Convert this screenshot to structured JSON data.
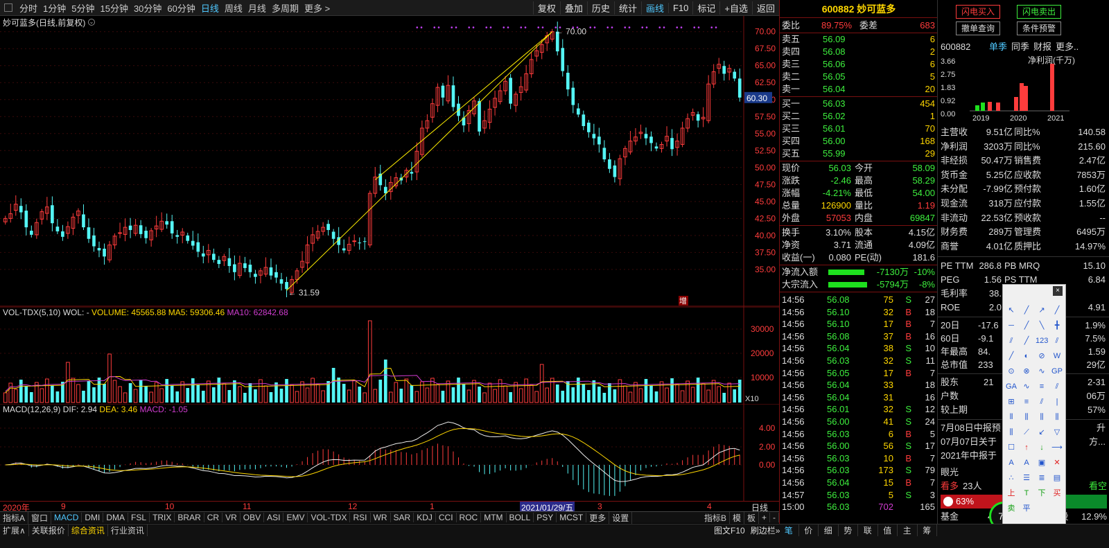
{
  "toolbar": {
    "left": [
      "分时",
      "1分钟",
      "5分钟",
      "15分钟",
      "30分钟",
      "60分钟",
      "日线",
      "周线",
      "月线",
      "多周期",
      "更多 >"
    ],
    "active": "日线",
    "right": [
      "复权",
      "叠加",
      "历史",
      "统计",
      "画线",
      "F10",
      "标记",
      "+自选",
      "返回"
    ],
    "right_active": "画线"
  },
  "chart": {
    "title": "妙可蓝多(日线,前复权)",
    "price_ticks": [
      "70.00",
      "67.50",
      "65.00",
      "62.50",
      "60.00",
      "57.50",
      "55.00",
      "52.50",
      "50.00",
      "47.50",
      "45.00",
      "42.50",
      "40.00",
      "37.50",
      "35.00"
    ],
    "current_price_tag": "60.30",
    "high_label": "70.00",
    "low_label": "31.59",
    "zeng_label": "增",
    "vol_title": "VOL-TDX(5,10)",
    "vol_wol": "WOL: -",
    "vol_volume": "VOLUME: 45565.88",
    "vol_ma5": "MA5: 59306.46",
    "vol_ma10": "MA10: 62842.68",
    "vol_ticks": [
      "30000",
      "20000",
      "10000"
    ],
    "vol_unit": "X10",
    "macd_title": "MACD(12,26,9)",
    "macd_dif": "DIF: 2.94",
    "macd_dea": "DEA: 3.46",
    "macd_val": "MACD: -1.05",
    "macd_ticks": [
      "4.00",
      "2.00",
      "0.00"
    ],
    "date_labels": [
      "2020年",
      "9",
      "10",
      "11",
      "12",
      "1",
      "2021/01/29/五",
      "3",
      "4"
    ],
    "period_label": "日线"
  },
  "chart_data": {
    "type": "candlestick",
    "price_range": [
      30.5,
      71.5
    ],
    "closes": [
      42.5,
      43.2,
      44.6,
      43.4,
      41.2,
      40.1,
      41.9,
      43.5,
      44.2,
      41.8,
      40.6,
      39.8,
      41.3,
      42.7,
      43.6,
      41.2,
      39.5,
      38.4,
      37.8,
      36.9,
      38.6,
      39.9,
      40.4,
      41.2,
      40.8,
      41.5,
      40.2,
      39.6,
      40.7,
      41.4,
      42.1,
      41.6,
      40.3,
      39.8,
      40.5,
      39.2,
      38.5,
      37.6,
      36.9,
      37.8,
      36.4,
      35.8,
      36.9,
      35.5,
      34.6,
      35.9,
      35.2,
      34.6,
      33.9,
      34.8,
      35.3,
      34.1,
      33.8,
      32.9,
      32.1,
      33.5,
      34.8,
      36.2,
      38.6,
      40.1,
      40.6,
      41.2,
      40.8,
      39.5,
      38.6,
      37.8,
      38.7,
      39.2,
      38.9,
      39.1,
      46.2,
      48.6,
      47.4,
      46.2,
      47.8,
      48.5,
      48.1,
      49.6,
      49.1,
      52.4,
      55.8,
      56.9,
      59.4,
      61.8,
      60.3,
      62.1,
      58.9,
      57.6,
      56.2,
      58.4,
      59.8,
      55.3,
      56.9,
      58.6,
      60.2,
      61.3,
      62.7,
      59.4,
      60.8,
      61.9,
      63.8,
      65.9,
      67.2,
      68.1,
      69.4,
      70.0,
      67.1,
      64.2,
      61.5,
      59.2,
      57.8,
      56.1,
      55.2,
      54.3,
      53.4,
      51.2,
      49.8,
      48.6,
      51.3,
      52.8,
      53.9,
      54.5,
      55.2,
      54.3,
      53.6,
      52.8,
      53.4,
      54.6,
      52.7,
      53.9,
      55.8,
      57.2,
      58.1,
      56.9,
      57.4,
      62.3,
      64.1,
      65.2,
      63.8,
      64.6,
      63.1,
      60.3
    ],
    "volume_ticks": [
      30000,
      20000,
      10000
    ],
    "macd_ticks": [
      4.0,
      2.0,
      0.0
    ]
  },
  "quote": {
    "code_name": "600882 妙可蓝多",
    "weibi_label": "委比",
    "weibi": "89.75%",
    "weicha_label": "委差",
    "weicha": "683",
    "sells": [
      {
        "label": "卖五",
        "price": "56.09",
        "vol": "6"
      },
      {
        "label": "卖四",
        "price": "56.08",
        "vol": "2"
      },
      {
        "label": "卖三",
        "price": "56.06",
        "vol": "6"
      },
      {
        "label": "卖二",
        "price": "56.05",
        "vol": "5"
      },
      {
        "label": "卖一",
        "price": "56.04",
        "vol": "20"
      }
    ],
    "buys": [
      {
        "label": "买一",
        "price": "56.03",
        "vol": "454"
      },
      {
        "label": "买二",
        "price": "56.02",
        "vol": "1"
      },
      {
        "label": "买三",
        "price": "56.01",
        "vol": "70"
      },
      {
        "label": "买四",
        "price": "56.00",
        "vol": "168"
      },
      {
        "label": "买五",
        "price": "55.99",
        "vol": "29"
      }
    ],
    "stats": [
      {
        "l1": "现价",
        "v1": "56.03",
        "l2": "今开",
        "v2": "58.09"
      },
      {
        "l1": "涨跌",
        "v1": "-2.46",
        "l2": "最高",
        "v2": "58.29"
      },
      {
        "l1": "涨幅",
        "v1": "-4.21%",
        "l2": "最低",
        "v2": "54.00"
      },
      {
        "l1": "总量",
        "v1": "126900",
        "l2": "量比",
        "v2": "1.19"
      },
      {
        "l1": "外盘",
        "v1": "57053",
        "l2": "内盘",
        "v2": "69847"
      }
    ],
    "stats2": [
      {
        "l1": "换手",
        "v1": "3.10%",
        "l2": "股本",
        "v2": "4.15亿"
      },
      {
        "l1": "净资",
        "v1": "3.71",
        "l2": "流通",
        "v2": "4.09亿"
      },
      {
        "l1": "收益(一)",
        "v1": "0.080",
        "l2": "PE(动)",
        "v2": "181.6"
      }
    ],
    "flows": [
      {
        "label": "净流入额",
        "val": "-7130万",
        "pct": "-10%"
      },
      {
        "label": "大宗流入",
        "val": "-5794万",
        "pct": "-8%"
      }
    ],
    "ticks": [
      {
        "t": "14:56",
        "p": "56.08",
        "v": "75",
        "s": "S",
        "n": "27"
      },
      {
        "t": "14:56",
        "p": "56.10",
        "v": "32",
        "s": "B",
        "n": "18"
      },
      {
        "t": "14:56",
        "p": "56.10",
        "v": "17",
        "s": "B",
        "n": "7"
      },
      {
        "t": "14:56",
        "p": "56.08",
        "v": "37",
        "s": "B",
        "n": "16"
      },
      {
        "t": "14:56",
        "p": "56.04",
        "v": "38",
        "s": "S",
        "n": "10"
      },
      {
        "t": "14:56",
        "p": "56.03",
        "v": "32",
        "s": "S",
        "n": "11"
      },
      {
        "t": "14:56",
        "p": "56.05",
        "v": "17",
        "s": "B",
        "n": "7"
      },
      {
        "t": "14:56",
        "p": "56.04",
        "v": "33",
        "s": "",
        "n": "18"
      },
      {
        "t": "14:56",
        "p": "56.04",
        "v": "31",
        "s": "",
        "n": "16"
      },
      {
        "t": "14:56",
        "p": "56.01",
        "v": "32",
        "s": "S",
        "n": "12"
      },
      {
        "t": "14:56",
        "p": "56.00",
        "v": "41",
        "s": "S",
        "n": "24"
      },
      {
        "t": "14:56",
        "p": "56.03",
        "v": "6",
        "s": "B",
        "n": "5"
      },
      {
        "t": "14:56",
        "p": "56.00",
        "v": "56",
        "s": "S",
        "n": "17"
      },
      {
        "t": "14:56",
        "p": "56.03",
        "v": "10",
        "s": "B",
        "n": "7"
      },
      {
        "t": "14:56",
        "p": "56.03",
        "v": "173",
        "s": "S",
        "n": "79"
      },
      {
        "t": "14:56",
        "p": "56.04",
        "v": "15",
        "s": "B",
        "n": "7"
      },
      {
        "t": "14:57",
        "p": "56.03",
        "v": "5",
        "s": "S",
        "n": "3"
      },
      {
        "t": "15:00",
        "p": "56.03",
        "v": "702",
        "s": "",
        "n": "165"
      }
    ],
    "bottom_tabs": [
      "笔",
      "价",
      "细",
      "势",
      "联",
      "值",
      "主",
      "筹"
    ]
  },
  "fin": {
    "buy_btn": "闪电买入",
    "sell_btn": "闪电卖出",
    "cancel_btn": "撤单查询",
    "cond_btn": "条件预警",
    "code": "600882",
    "tabs": [
      "单季",
      "同季",
      "财报",
      "更多.."
    ],
    "chart_title": "净利润(千万)",
    "y_ticks": [
      "3.66",
      "2.75",
      "1.83",
      "0.92",
      "0.00"
    ],
    "x_ticks": [
      "2019",
      "2020",
      "2021"
    ],
    "rows": [
      {
        "l1": "主营收",
        "v1": "9.51亿",
        "l2": "同比%",
        "v2": "140.58"
      },
      {
        "l1": "净利润",
        "v1": "3203万",
        "l2": "同比%",
        "v2": "215.60"
      },
      {
        "l1": "非经损",
        "v1": "50.47万",
        "l2": "销售费",
        "v2": "2.47亿"
      },
      {
        "l1": "货币金",
        "v1": "5.25亿",
        "l2": "应收款",
        "v2": "7853万"
      },
      {
        "l1": "未分配",
        "v1": "-7.99亿",
        "l2": "预付款",
        "v2": "1.60亿"
      },
      {
        "l1": "现金流",
        "v1": "318万",
        "l2": "应付款",
        "v2": "1.55亿"
      },
      {
        "l1": "非流动",
        "v1": "22.53亿",
        "l2": "预收款",
        "v2": "--"
      },
      {
        "l1": "财务费",
        "v1": "289万",
        "l2": "管理费",
        "v2": "6495万"
      },
      {
        "l1": "商誉",
        "v1": "4.01亿",
        "l2": "质押比",
        "v2": "14.97%"
      }
    ],
    "val_rows": [
      {
        "l1": "PE TTM",
        "v1": "286.8",
        "l2": "PB MRQ",
        "v2": "15.10"
      },
      {
        "l1": "PEG",
        "v1": "1.56",
        "l2": "PS TTM",
        "v2": "6.84"
      },
      {
        "l1": "毛利率",
        "v1": "38.",
        "l2": "",
        "v2": ""
      },
      {
        "l1": "ROE",
        "v1": "2.0",
        "l2": "",
        "v2": "4.91"
      }
    ],
    "perf_rows": [
      {
        "l1": "20日",
        "v1": "-17.6",
        "v2": "1.9%"
      },
      {
        "l1": "60日",
        "v1": "-9.1",
        "v2": "7.5%"
      },
      {
        "l1": "年最高",
        "v1": "84.",
        "v2": "1.59"
      },
      {
        "l1": "总市值",
        "v1": "233",
        "v2": "29亿"
      }
    ],
    "holder_rows": [
      {
        "l1": "股东",
        "v1": "21",
        "v2": "2-31"
      },
      {
        "l1": "户数",
        "v1": "",
        "v2": "06万"
      },
      {
        "l1": "较上期",
        "v1": "",
        "v2": "57%"
      }
    ],
    "news": [
      "7月08日中报预",
      "07月07日关于",
      "2021年中报于"
    ],
    "news_tail": [
      "升",
      "方...",
      ""
    ],
    "eye_label": "眼光",
    "kanduo": "看多",
    "people": "23人",
    "kankong": "看空",
    "pct": "63%",
    "bottom_left": "基金",
    "bottom_mid": "42",
    "bottom_r": "57万股",
    "bottom_rr": "12.9%",
    "circle": "75"
  },
  "indicators": [
    "指标A",
    "窗口",
    "MACD",
    "DMI",
    "DMA",
    "FSL",
    "TRIX",
    "BRAR",
    "CR",
    "VR",
    "OBV",
    "ASI",
    "EMV",
    "VOL-TDX",
    "RSI",
    "WR",
    "SAR",
    "KDJ",
    "CCI",
    "ROC",
    "MTM",
    "BOLL",
    "PSY",
    "MCST",
    "更多",
    "设置"
  ],
  "indicators_active": "MACD",
  "ind_right": [
    "指标B",
    "模",
    "板",
    "+",
    "-"
  ],
  "status": {
    "items": [
      "扩展∧",
      "关联报价",
      "综合资讯",
      "行业资讯"
    ],
    "right": [
      "图文F10",
      "刷边栏»"
    ]
  },
  "drawtools": {
    "row1": [
      "↖",
      "╱",
      "↗"
    ],
    "labels": [
      "A",
      "A",
      "✕",
      "上",
      "T",
      "下",
      "买",
      "卖",
      "平"
    ]
  }
}
